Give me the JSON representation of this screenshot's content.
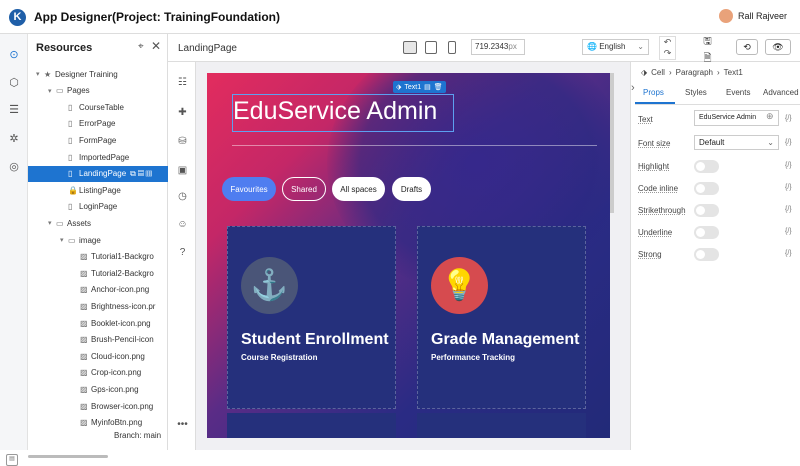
{
  "app": {
    "title": "App Designer(Project: TrainingFoundation)",
    "logo_letter": "K",
    "user": "Rall Rajveer"
  },
  "resources": {
    "title": "Resources",
    "tree": [
      {
        "label": "Designer Training",
        "depth": 0,
        "icon": "star-icon",
        "arrow": "▾"
      },
      {
        "label": "Pages",
        "depth": 1,
        "icon": "folder-icon",
        "arrow": "▾"
      },
      {
        "label": "CourseTable",
        "depth": 2,
        "icon": "page-icon"
      },
      {
        "label": "ErrorPage",
        "depth": 2,
        "icon": "page-icon"
      },
      {
        "label": "FormPage",
        "depth": 2,
        "icon": "page-icon"
      },
      {
        "label": "ImportedPage",
        "depth": 2,
        "icon": "page-icon"
      },
      {
        "label": "LandingPage",
        "depth": 2,
        "icon": "page-icon",
        "selected": true
      },
      {
        "label": "ListingPage",
        "depth": 2,
        "icon": "lock-icon"
      },
      {
        "label": "LoginPage",
        "depth": 2,
        "icon": "page-icon"
      },
      {
        "label": "Assets",
        "depth": 1,
        "icon": "folder-icon",
        "arrow": "▾"
      },
      {
        "label": "image",
        "depth": 2,
        "icon": "folder-icon",
        "arrow": "▾"
      },
      {
        "label": "Tutorial1-Backgro",
        "depth": 3,
        "icon": "image-icon"
      },
      {
        "label": "Tutorial2-Backgro",
        "depth": 3,
        "icon": "image-icon"
      },
      {
        "label": "Anchor-icon.png",
        "depth": 3,
        "icon": "image-icon"
      },
      {
        "label": "Brightness-icon.pr",
        "depth": 3,
        "icon": "image-icon"
      },
      {
        "label": "Booklet-icon.png",
        "depth": 3,
        "icon": "image-icon"
      },
      {
        "label": "Brush-Pencil-icon",
        "depth": 3,
        "icon": "image-icon"
      },
      {
        "label": "Cloud-icon.png",
        "depth": 3,
        "icon": "image-icon"
      },
      {
        "label": "Crop-icon.png",
        "depth": 3,
        "icon": "image-icon"
      },
      {
        "label": "Gps-icon.png",
        "depth": 3,
        "icon": "image-icon"
      },
      {
        "label": "Browser-icon.png",
        "depth": 3,
        "icon": "image-icon"
      },
      {
        "label": "MyinfoBtn.png",
        "depth": 3,
        "icon": "image-icon"
      }
    ],
    "branch": "Branch: main"
  },
  "toolbar": {
    "page_name": "LandingPage",
    "width_value": "719.2343",
    "width_unit": "px",
    "language": "English"
  },
  "canvas": {
    "selection_chip": "Text1",
    "heading": "EduService Admin",
    "pills": [
      "Favourites",
      "Shared",
      "All spaces",
      "Drafts"
    ],
    "cards": [
      {
        "title": "Student Enrollment",
        "subtitle": "Course Registration",
        "icon": "anchor-icon"
      },
      {
        "title": "Grade Management",
        "subtitle": "Performance Tracking",
        "icon": "lightbulb-icon"
      }
    ]
  },
  "props": {
    "breadcrumb": [
      "Cell",
      "Paragraph",
      "Text1"
    ],
    "tabs": [
      "Props",
      "Styles",
      "Events",
      "Advanced"
    ],
    "text_label": "Text",
    "text_value": "EduService Admin",
    "font_size_label": "Font size",
    "font_size_value": "Default",
    "toggles": [
      "Highlight",
      "Code inline",
      "Strikethrough",
      "Underline",
      "Strong"
    ],
    "fx": "{/}"
  },
  "colors": {
    "accent": "#1e74d0",
    "pill_active": "#4f7df0",
    "card_bg": "#25307c"
  }
}
